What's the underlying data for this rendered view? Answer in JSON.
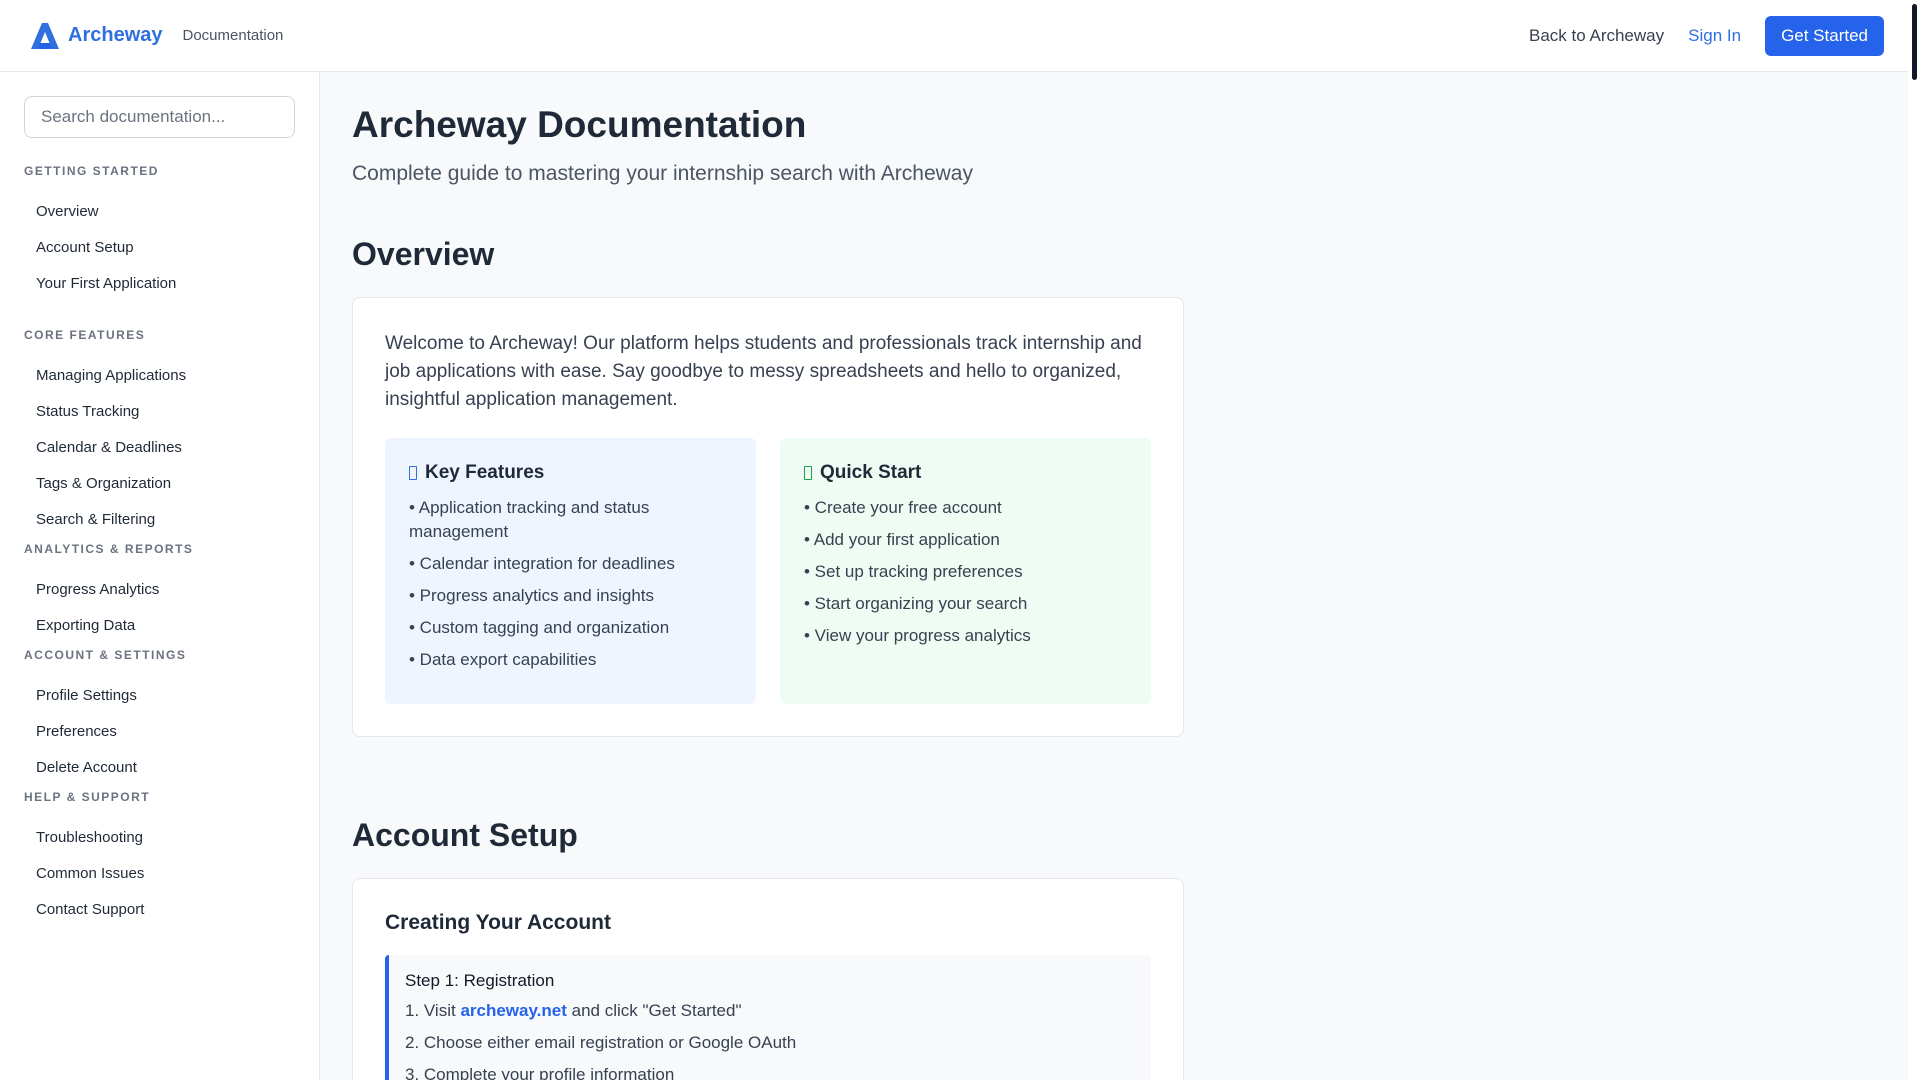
{
  "header": {
    "brand_name": "Archeway",
    "brand_sub": "Documentation",
    "back_link": "Back to Archeway",
    "sign_in": "Sign In",
    "get_started": "Get Started",
    "logo_icon": "archeway-logo-icon",
    "accent_color": "#2563eb"
  },
  "sidebar": {
    "search_placeholder": "Search documentation...",
    "sections": [
      {
        "heading": "GETTING STARTED",
        "items": [
          "Overview",
          "Account Setup",
          "Your First Application"
        ]
      },
      {
        "heading": "CORE FEATURES",
        "items": [
          "Managing Applications",
          "Status Tracking",
          "Calendar & Deadlines",
          "Tags & Organization",
          "Search & Filtering"
        ]
      },
      {
        "heading": "ANALYTICS & REPORTS",
        "items": [
          "Progress Analytics",
          "Exporting Data"
        ]
      },
      {
        "heading": "ACCOUNT & SETTINGS",
        "items": [
          "Profile Settings",
          "Preferences",
          "Delete Account"
        ]
      },
      {
        "heading": "HELP & SUPPORT",
        "items": [
          "Troubleshooting",
          "Common Issues",
          "Contact Support"
        ]
      }
    ]
  },
  "main": {
    "title": "Archeway Documentation",
    "subtitle": "Complete guide to mastering your internship search with Archeway",
    "overview": {
      "title": "Overview",
      "text": "Welcome to Archeway! Our platform helps students and professionals track internship and job applications with ease. Say goodbye to messy spreadsheets and hello to organized, insightful application management.",
      "key_features": {
        "title": "Key Features",
        "icon": "feature-icon",
        "items": [
          "• Application tracking and status management",
          "• Calendar integration for deadlines",
          "• Progress analytics and insights",
          "• Custom tagging and organization",
          "• Data export capabilities"
        ]
      },
      "quick_start": {
        "title": "Quick Start",
        "icon": "quick-start-icon",
        "items": [
          "• Create your free account",
          "• Add your first application",
          "• Set up tracking preferences",
          "• Start organizing your search",
          "• View your progress analytics"
        ]
      }
    },
    "account_setup": {
      "title": "Account Setup",
      "card_title": "Creating Your Account",
      "step_title": "Step 1: Registration",
      "step1_prefix": "1. Visit ",
      "step1_link": "archeway.net",
      "step1_suffix": " and click \"Get Started\"",
      "step2": "2. Choose either email registration or Google OAuth",
      "step3": "3. Complete your profile information"
    }
  }
}
